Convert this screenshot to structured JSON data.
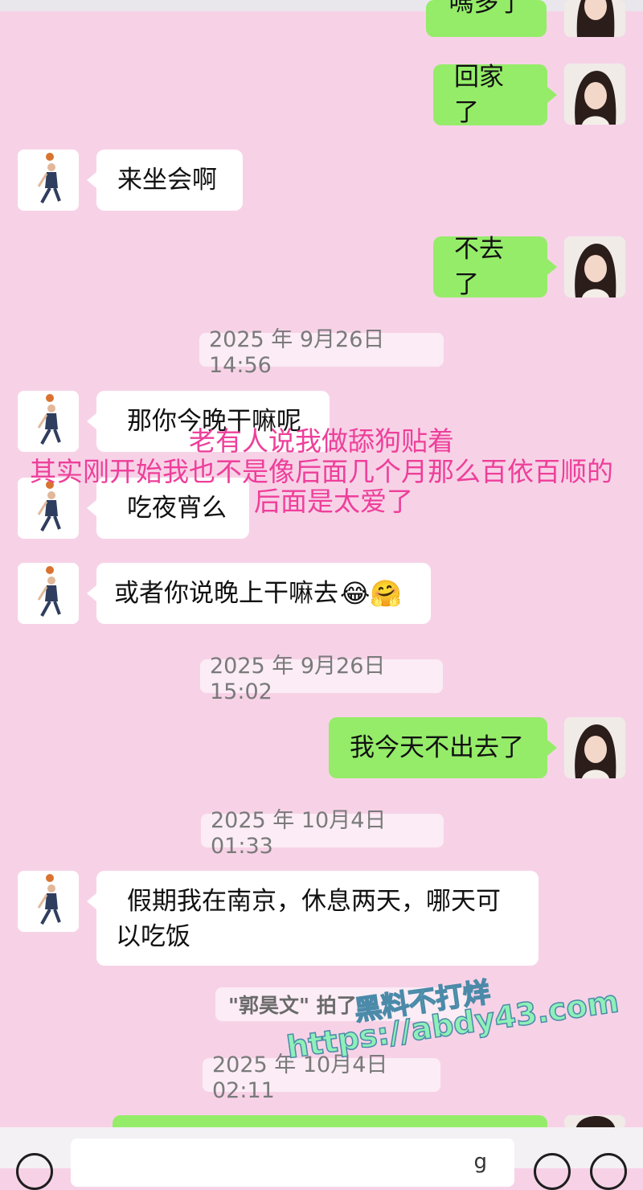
{
  "messages": {
    "m_cut": "嗎多了",
    "m1": "回家了",
    "m2": "来坐会啊",
    "m3": "不去了",
    "m4": "那你今晚干嘛呢",
    "m5": "吃夜宵么",
    "m6": "或者你说晚上干嘛去",
    "m7": "我今天不出去了",
    "m8_line1": "假期我在南京，休息两天，哪天可",
    "m8_line2": "以吃饭"
  },
  "emojis": [
    "😂",
    "🤗"
  ],
  "timestamps": {
    "t1": "2025 年 9月26日 14:56",
    "t2": "2025 年 9月26日 15:02",
    "t3": "2025 年 10月4日 01:33",
    "t4": "2025 年 10月4日 02:11"
  },
  "system": {
    "pat_notice": "\"郭昊文\" 拍了"
  },
  "overlay_text": {
    "line1": "老有人说我做舔狗贴着",
    "line2": "其实刚开始我也不是像后面几个月那么百依百顺的",
    "line3": "后面是太爱了"
  },
  "watermark": {
    "line1": "黑料不打烊",
    "line2": "https://abdy43.com"
  },
  "input_bar": {
    "cursor_glyph": "g"
  },
  "colors": {
    "background": "#f7d2e7",
    "my_bubble": "#95ec69",
    "peer_bubble": "#ffffff",
    "overlay_pink": "#ee3f9a"
  }
}
